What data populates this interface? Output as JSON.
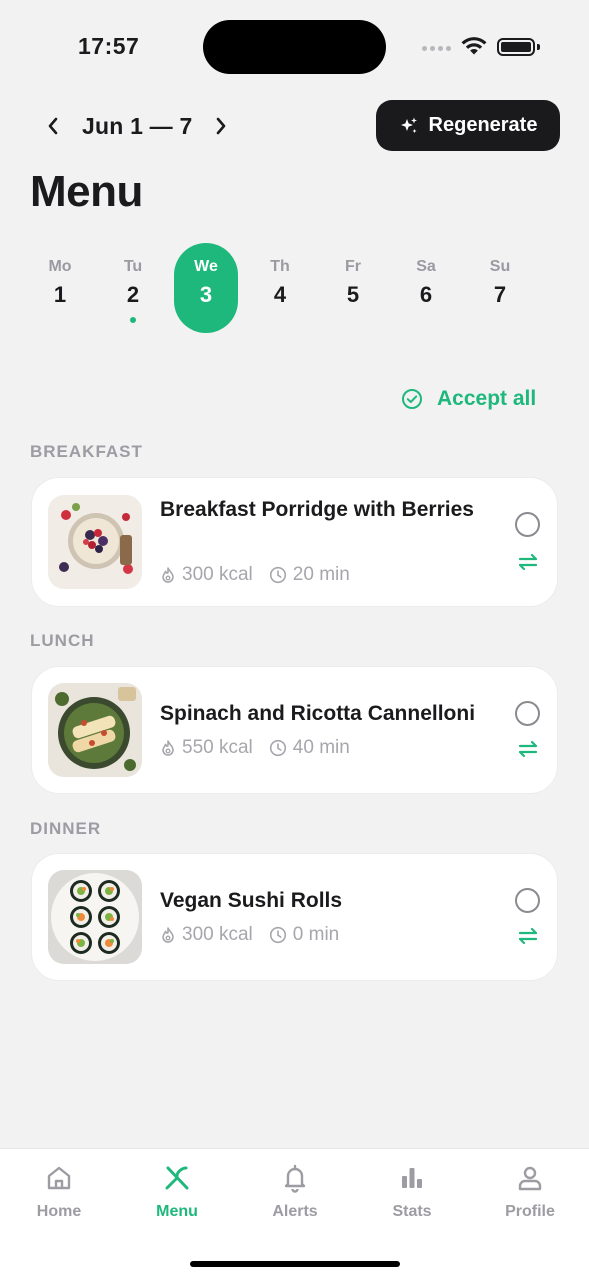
{
  "status_bar": {
    "time": "17:57"
  },
  "header": {
    "week_label": "Jun 1 — 7",
    "regenerate_label": "Regenerate",
    "title": "Menu"
  },
  "days": [
    {
      "abbr": "Mo",
      "num": "1",
      "selected": false,
      "dot": false
    },
    {
      "abbr": "Tu",
      "num": "2",
      "selected": false,
      "dot": true
    },
    {
      "abbr": "We",
      "num": "3",
      "selected": true,
      "dot": false
    },
    {
      "abbr": "Th",
      "num": "4",
      "selected": false,
      "dot": false
    },
    {
      "abbr": "Fr",
      "num": "5",
      "selected": false,
      "dot": false
    },
    {
      "abbr": "Sa",
      "num": "6",
      "selected": false,
      "dot": false
    },
    {
      "abbr": "Su",
      "num": "7",
      "selected": false,
      "dot": false
    }
  ],
  "accept_all_label": "Accept all",
  "meals": [
    {
      "section": "BREAKFAST",
      "title": "Breakfast Porridge with Berries",
      "kcal": "300 kcal",
      "time": "20 min",
      "image": "porridge-bowl-image",
      "checked": false
    },
    {
      "section": "LUNCH",
      "title": "Spinach and Ricotta Cannelloni",
      "kcal": "550 kcal",
      "time": "40 min",
      "image": "cannelloni-plate-image",
      "checked": false
    },
    {
      "section": "DINNER",
      "title": "Vegan Sushi Rolls",
      "kcal": "300 kcal",
      "time": "0 min",
      "image": "sushi-plate-image",
      "checked": false
    }
  ],
  "tabs": [
    {
      "label": "Home",
      "icon": "home-icon",
      "active": false
    },
    {
      "label": "Menu",
      "icon": "fork-knife-icon",
      "active": true
    },
    {
      "label": "Alerts",
      "icon": "bell-icon",
      "active": false
    },
    {
      "label": "Stats",
      "icon": "bar-chart-icon",
      "active": false
    },
    {
      "label": "Profile",
      "icon": "user-icon",
      "active": false
    }
  ],
  "colors": {
    "accent": "#1fb87c",
    "background": "#f2f2f3",
    "button_dark": "#1a1a1c",
    "muted_text": "#9c9ca2"
  }
}
